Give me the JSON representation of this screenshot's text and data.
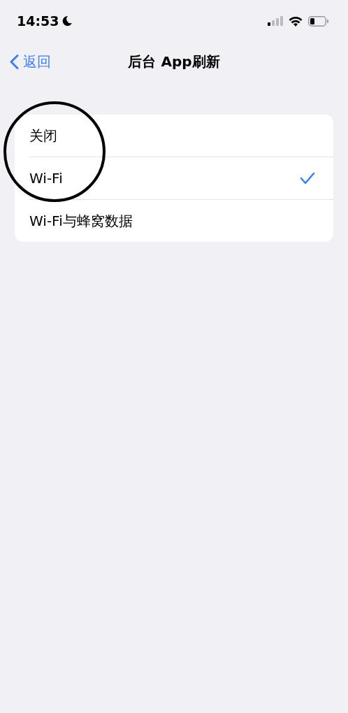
{
  "status_bar": {
    "time": "14:53"
  },
  "nav": {
    "back": "返回",
    "title": "后台 App刷新"
  },
  "options": [
    {
      "label": "关闭",
      "selected": false
    },
    {
      "label": "Wi-Fi",
      "selected": true
    },
    {
      "label": "Wi-Fi与蜂窝数据",
      "selected": false
    }
  ]
}
